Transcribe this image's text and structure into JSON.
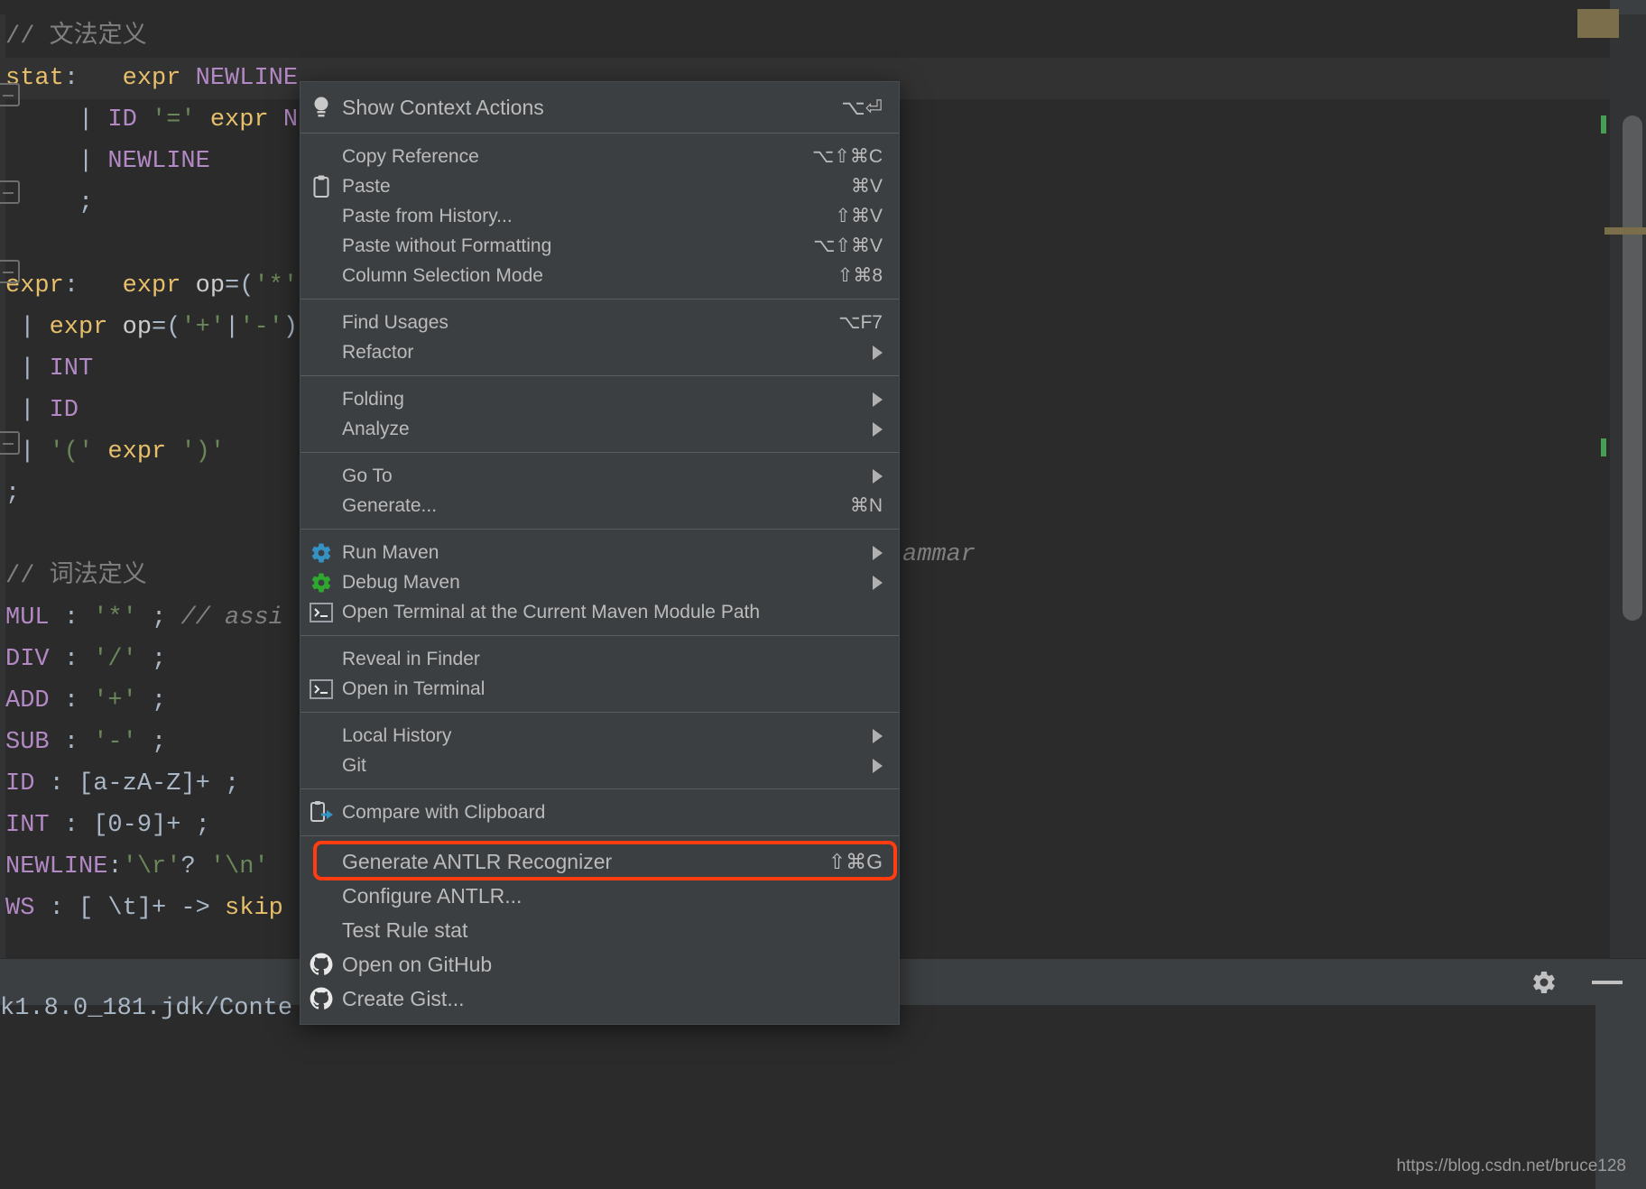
{
  "editor": {
    "lines": [
      {
        "hl": false,
        "segments": [
          {
            "t": "// 文法定义",
            "c": "cmt"
          }
        ]
      },
      {
        "hl": true,
        "segments": [
          {
            "t": "stat",
            "c": "rule"
          },
          {
            "t": ":",
            "c": "pun"
          },
          {
            "t": "   ",
            "c": "pun"
          },
          {
            "t": "expr",
            "c": "rule"
          },
          {
            "t": " ",
            "c": "pun"
          },
          {
            "t": "NEWLINE",
            "c": "tok"
          }
        ]
      },
      {
        "hl": false,
        "segments": [
          {
            "t": "     | ",
            "c": "pun"
          },
          {
            "t": "ID",
            "c": "tok"
          },
          {
            "t": " ",
            "c": "pun"
          },
          {
            "t": "'='",
            "c": "str"
          },
          {
            "t": " ",
            "c": "pun"
          },
          {
            "t": "expr",
            "c": "rule"
          },
          {
            "t": " ",
            "c": "pun"
          },
          {
            "t": "N",
            "c": "tok"
          }
        ]
      },
      {
        "hl": false,
        "segments": [
          {
            "t": "     | ",
            "c": "pun"
          },
          {
            "t": "NEWLINE",
            "c": "tok"
          }
        ]
      },
      {
        "hl": false,
        "segments": [
          {
            "t": "     ;",
            "c": "pun"
          }
        ]
      },
      {
        "hl": false,
        "segments": [
          {
            "t": "",
            "c": "pun"
          }
        ]
      },
      {
        "hl": false,
        "segments": [
          {
            "t": "expr",
            "c": "rule"
          },
          {
            "t": ":",
            "c": "pun"
          },
          {
            "t": "   ",
            "c": "pun"
          },
          {
            "t": "expr",
            "c": "rule"
          },
          {
            "t": " ",
            "c": "pun"
          },
          {
            "t": "op",
            "c": "op"
          },
          {
            "t": "=(",
            "c": "pun"
          },
          {
            "t": "'*'",
            "c": "str"
          }
        ]
      },
      {
        "hl": false,
        "segments": [
          {
            "t": " | ",
            "c": "pun"
          },
          {
            "t": "expr",
            "c": "rule"
          },
          {
            "t": " ",
            "c": "pun"
          },
          {
            "t": "op",
            "c": "op"
          },
          {
            "t": "=(",
            "c": "pun"
          },
          {
            "t": "'+'",
            "c": "str"
          },
          {
            "t": "|",
            "c": "pun"
          },
          {
            "t": "'-'",
            "c": "str"
          },
          {
            "t": ")",
            "c": "pun"
          }
        ]
      },
      {
        "hl": false,
        "segments": [
          {
            "t": " | ",
            "c": "pun"
          },
          {
            "t": "INT",
            "c": "tok"
          }
        ]
      },
      {
        "hl": false,
        "segments": [
          {
            "t": " | ",
            "c": "pun"
          },
          {
            "t": "ID",
            "c": "tok"
          }
        ]
      },
      {
        "hl": false,
        "segments": [
          {
            "t": " | ",
            "c": "pun"
          },
          {
            "t": "'('",
            "c": "str"
          },
          {
            "t": " ",
            "c": "pun"
          },
          {
            "t": "expr",
            "c": "rule"
          },
          {
            "t": " ",
            "c": "pun"
          },
          {
            "t": "')'",
            "c": "str"
          }
        ]
      },
      {
        "hl": false,
        "segments": [
          {
            "t": ";",
            "c": "pun"
          }
        ]
      },
      {
        "hl": false,
        "segments": [
          {
            "t": "",
            "c": "pun"
          }
        ]
      },
      {
        "hl": false,
        "segments": [
          {
            "t": "// 词法定义",
            "c": "cmt"
          }
        ]
      },
      {
        "hl": false,
        "segments": [
          {
            "t": "MUL",
            "c": "tok"
          },
          {
            "t": " ",
            "c": "pun"
          },
          {
            "t": ":",
            "c": "pun"
          },
          {
            "t": " ",
            "c": "pun"
          },
          {
            "t": "'*'",
            "c": "str"
          },
          {
            "t": " ",
            "c": "pun"
          },
          {
            "t": ";",
            "c": "pun"
          },
          {
            "t": " ",
            "c": "pun"
          },
          {
            "t": "// assi",
            "c": "cmt-i"
          }
        ]
      },
      {
        "hl": false,
        "segments": [
          {
            "t": "DIV",
            "c": "tok"
          },
          {
            "t": " ",
            "c": "pun"
          },
          {
            "t": ":",
            "c": "pun"
          },
          {
            "t": " ",
            "c": "pun"
          },
          {
            "t": "'/'",
            "c": "str"
          },
          {
            "t": " ",
            "c": "pun"
          },
          {
            "t": ";",
            "c": "pun"
          }
        ]
      },
      {
        "hl": false,
        "segments": [
          {
            "t": "ADD",
            "c": "tok"
          },
          {
            "t": " ",
            "c": "pun"
          },
          {
            "t": ":",
            "c": "pun"
          },
          {
            "t": " ",
            "c": "pun"
          },
          {
            "t": "'+'",
            "c": "str"
          },
          {
            "t": " ",
            "c": "pun"
          },
          {
            "t": ";",
            "c": "pun"
          }
        ]
      },
      {
        "hl": false,
        "segments": [
          {
            "t": "SUB",
            "c": "tok"
          },
          {
            "t": " ",
            "c": "pun"
          },
          {
            "t": ":",
            "c": "pun"
          },
          {
            "t": " ",
            "c": "pun"
          },
          {
            "t": "'-'",
            "c": "str"
          },
          {
            "t": " ",
            "c": "pun"
          },
          {
            "t": ";",
            "c": "pun"
          }
        ]
      },
      {
        "hl": false,
        "segments": [
          {
            "t": "ID",
            "c": "tok"
          },
          {
            "t": " ",
            "c": "pun"
          },
          {
            "t": ":",
            "c": "pun"
          },
          {
            "t": " ",
            "c": "pun"
          },
          {
            "t": "[a-zA-Z]+",
            "c": "pun"
          },
          {
            "t": " ",
            "c": "pun"
          },
          {
            "t": ";",
            "c": "pun"
          }
        ]
      },
      {
        "hl": false,
        "segments": [
          {
            "t": "INT",
            "c": "tok"
          },
          {
            "t": " ",
            "c": "pun"
          },
          {
            "t": ":",
            "c": "pun"
          },
          {
            "t": " ",
            "c": "pun"
          },
          {
            "t": "[0-9]+",
            "c": "pun"
          },
          {
            "t": " ",
            "c": "pun"
          },
          {
            "t": ";",
            "c": "pun"
          }
        ]
      },
      {
        "hl": false,
        "segments": [
          {
            "t": "NEWLINE",
            "c": "tok"
          },
          {
            "t": ":",
            "c": "pun"
          },
          {
            "t": "'\\r'",
            "c": "str"
          },
          {
            "t": "? ",
            "c": "pun"
          },
          {
            "t": "'\\n'",
            "c": "str"
          }
        ]
      },
      {
        "hl": false,
        "segments": [
          {
            "t": "WS",
            "c": "tok"
          },
          {
            "t": " ",
            "c": "pun"
          },
          {
            "t": ":",
            "c": "pun"
          },
          {
            "t": " ",
            "c": "pun"
          },
          {
            "t": "[ \\t]+",
            "c": "pun"
          },
          {
            "t": " -> ",
            "c": "pun"
          },
          {
            "t": "skip",
            "c": "rule"
          }
        ]
      }
    ],
    "right_comment": "ammar",
    "console_path": "k1.8.0_181.jdk/Conte"
  },
  "toolbar": {
    "settings_icon": "gear-icon",
    "minimize_icon": "minimize-icon"
  },
  "watermark": "https://blog.csdn.net/bruce128",
  "menu": {
    "groups": [
      {
        "items": [
          {
            "label": "Show Context Actions",
            "shortcut": "⌥⏎",
            "icon": "lightbulb-icon",
            "arrow": false,
            "big": true,
            "highlight": false
          }
        ]
      },
      {
        "items": [
          {
            "label": "Copy Reference",
            "shortcut": "⌥⇧⌘C",
            "icon": "",
            "arrow": false,
            "big": false,
            "highlight": false
          },
          {
            "label": "Paste",
            "shortcut": "⌘V",
            "icon": "clipboard-icon",
            "arrow": false,
            "big": false,
            "highlight": false
          },
          {
            "label": "Paste from History...",
            "shortcut": "⇧⌘V",
            "icon": "",
            "arrow": false,
            "big": false,
            "highlight": false
          },
          {
            "label": "Paste without Formatting",
            "shortcut": "⌥⇧⌘V",
            "icon": "",
            "arrow": false,
            "big": false,
            "highlight": false
          },
          {
            "label": "Column Selection Mode",
            "shortcut": "⇧⌘8",
            "icon": "",
            "arrow": false,
            "big": false,
            "highlight": false
          }
        ]
      },
      {
        "items": [
          {
            "label": "Find Usages",
            "shortcut": "⌥F7",
            "icon": "",
            "arrow": false,
            "big": false,
            "highlight": false
          },
          {
            "label": "Refactor",
            "shortcut": "",
            "icon": "",
            "arrow": true,
            "big": false,
            "highlight": false
          }
        ]
      },
      {
        "items": [
          {
            "label": "Folding",
            "shortcut": "",
            "icon": "",
            "arrow": true,
            "big": false,
            "highlight": false
          },
          {
            "label": "Analyze",
            "shortcut": "",
            "icon": "",
            "arrow": true,
            "big": false,
            "highlight": false
          }
        ]
      },
      {
        "items": [
          {
            "label": "Go To",
            "shortcut": "",
            "icon": "",
            "arrow": true,
            "big": false,
            "highlight": false
          },
          {
            "label": "Generate...",
            "shortcut": "⌘N",
            "icon": "",
            "arrow": false,
            "big": false,
            "highlight": false
          }
        ]
      },
      {
        "items": [
          {
            "label": "Run Maven",
            "shortcut": "",
            "icon": "gear-blue-icon",
            "arrow": true,
            "big": false,
            "highlight": false
          },
          {
            "label": "Debug Maven",
            "shortcut": "",
            "icon": "gear-green-icon",
            "arrow": true,
            "big": false,
            "highlight": false
          },
          {
            "label": "Open Terminal at the Current Maven Module Path",
            "shortcut": "",
            "icon": "terminal-icon",
            "arrow": false,
            "big": false,
            "highlight": false
          }
        ]
      },
      {
        "items": [
          {
            "label": "Reveal in Finder",
            "shortcut": "",
            "icon": "",
            "arrow": false,
            "big": false,
            "highlight": false
          },
          {
            "label": "Open in Terminal",
            "shortcut": "",
            "icon": "terminal-icon",
            "arrow": false,
            "big": false,
            "highlight": false
          }
        ]
      },
      {
        "items": [
          {
            "label": "Local History",
            "shortcut": "",
            "icon": "",
            "arrow": true,
            "big": false,
            "highlight": false
          },
          {
            "label": "Git",
            "shortcut": "",
            "icon": "",
            "arrow": true,
            "big": false,
            "highlight": false
          }
        ]
      },
      {
        "items": [
          {
            "label": "Compare with Clipboard",
            "shortcut": "",
            "icon": "compare-clipboard-icon",
            "arrow": false,
            "big": false,
            "highlight": false
          }
        ]
      },
      {
        "items": [
          {
            "label": "Generate ANTLR Recognizer",
            "shortcut": "⇧⌘G",
            "icon": "",
            "arrow": false,
            "big": true,
            "highlight": true
          },
          {
            "label": "Configure ANTLR...",
            "shortcut": "",
            "icon": "",
            "arrow": false,
            "big": true,
            "highlight": false
          },
          {
            "label": "Test Rule stat",
            "shortcut": "",
            "icon": "",
            "arrow": false,
            "big": true,
            "highlight": false
          },
          {
            "label": "Open on GitHub",
            "shortcut": "",
            "icon": "github-icon",
            "arrow": false,
            "big": true,
            "highlight": false
          },
          {
            "label": "Create Gist...",
            "shortcut": "",
            "icon": "github-icon",
            "arrow": false,
            "big": true,
            "highlight": false
          }
        ]
      }
    ],
    "highlight_color": "#ff3d11"
  }
}
